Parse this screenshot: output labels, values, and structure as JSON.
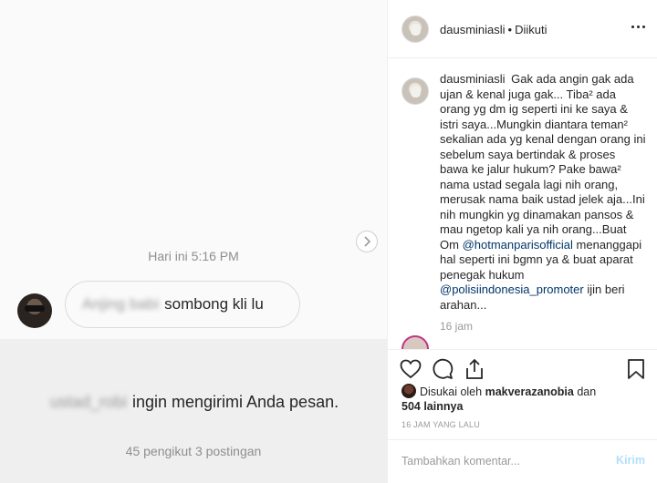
{
  "dm": {
    "timestamp": "Hari ini 5:16 PM",
    "message_blurred": "Anjing babi",
    "message_text": "sombong kli lu",
    "request_user_blurred": "ustad_robi",
    "request_text": "ingin mengirimi Anda pesan.",
    "request_stats": "45 pengikut 3 postingan"
  },
  "post": {
    "username": "dausminiasli",
    "separator": "•",
    "follow_status": "Diikuti",
    "caption_user": "dausminiasli",
    "caption_part1": "Gak ada angin gak ada ujan & kenal juga gak... Tiba² ada orang yg dm ig seperti ini ke saya & istri saya...Mungkin diantara teman² sekalian ada yg kenal dengan orang ini sebelum saya bertindak & proses bawa ke jalur hukum? Pake bawa² nama ustad segala lagi nih orang, merusak nama baik ustad jelek aja...Ini nih mungkin yg dinamakan pansos & mau ngetop kali ya nih orang...Buat Om ",
    "mention1": "@hotmanparisofficial",
    "caption_part2": " menanggapi hal seperti ini bgmn ya & buat aparat penegak hukum ",
    "mention2": "@polisiindonesia_promoter",
    "caption_part3": " ijin beri arahan...",
    "caption_time": "16 jam",
    "liked_by_prefix": "Disukai oleh",
    "liked_by_user": "makverazanobia",
    "liked_by_and": "dan",
    "liked_by_count": "504 lainnya",
    "post_date": "16 JAM YANG LALU",
    "comment_placeholder": "Tambahkan komentar...",
    "post_button": "Kirim"
  },
  "icons": {
    "like": "heart-icon",
    "comment": "comment-icon",
    "share": "share-icon",
    "save": "bookmark-icon",
    "more": "more-dots-icon",
    "next": "chevron-right-icon"
  }
}
